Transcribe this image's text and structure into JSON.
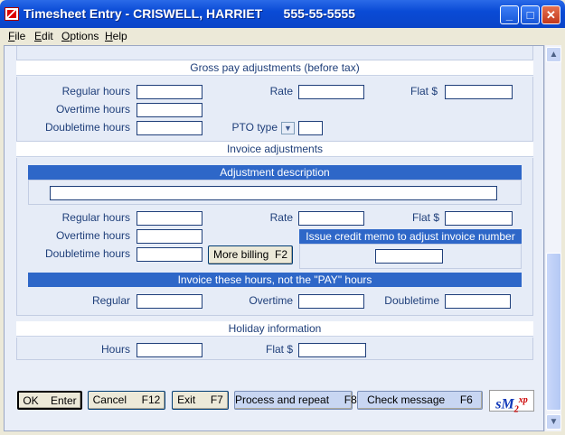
{
  "window": {
    "title": "Timesheet Entry - CRISWELL, HARRIET      555-55-5555"
  },
  "menu": [
    {
      "label": "File",
      "u": "F",
      "rest": "ile"
    },
    {
      "label": "Edit",
      "u": "E",
      "rest": "dit"
    },
    {
      "label": "Options",
      "u": "O",
      "rest": "ptions"
    },
    {
      "label": "Help",
      "u": "H",
      "rest": "elp"
    }
  ],
  "gross": {
    "header": "Gross pay adjustments  (before tax)",
    "regular_hours": "Regular hours",
    "overtime_hours": "Overtime hours",
    "doubletime_hours": "Doubletime hours",
    "rate": "Rate",
    "flat": "Flat $",
    "pto_type": "PTO type"
  },
  "invoice": {
    "header": "Invoice adjustments",
    "adj_desc": "Adjustment description",
    "regular_hours": "Regular hours",
    "overtime_hours": "Overtime hours",
    "doubletime_hours": "Doubletime hours",
    "rate": "Rate",
    "flat": "Flat $",
    "more_billing": "More billing  F2",
    "credit_memo": "Issue credit memo to adjust invoice number",
    "not_pay_header": "Invoice these hours, not the \"PAY\" hours",
    "regular": "Regular",
    "overtime": "Overtime",
    "doubletime": "Doubletime"
  },
  "holiday": {
    "header": "Holiday information",
    "hours": "Hours",
    "flat": "Flat $"
  },
  "buttons": {
    "ok": "OK    Enter",
    "cancel": "Cancel     F12",
    "exit": "Exit     F7",
    "process": "Process and repeat     F8",
    "check": "Check message     F6"
  },
  "logo": {
    "text_a": "sM",
    "text_b": "2",
    "text_c": "xp"
  },
  "colors": {
    "title_blue": "#0a4bd6",
    "header_blue": "#2e67c8",
    "label_blue": "#1f3f7a"
  }
}
